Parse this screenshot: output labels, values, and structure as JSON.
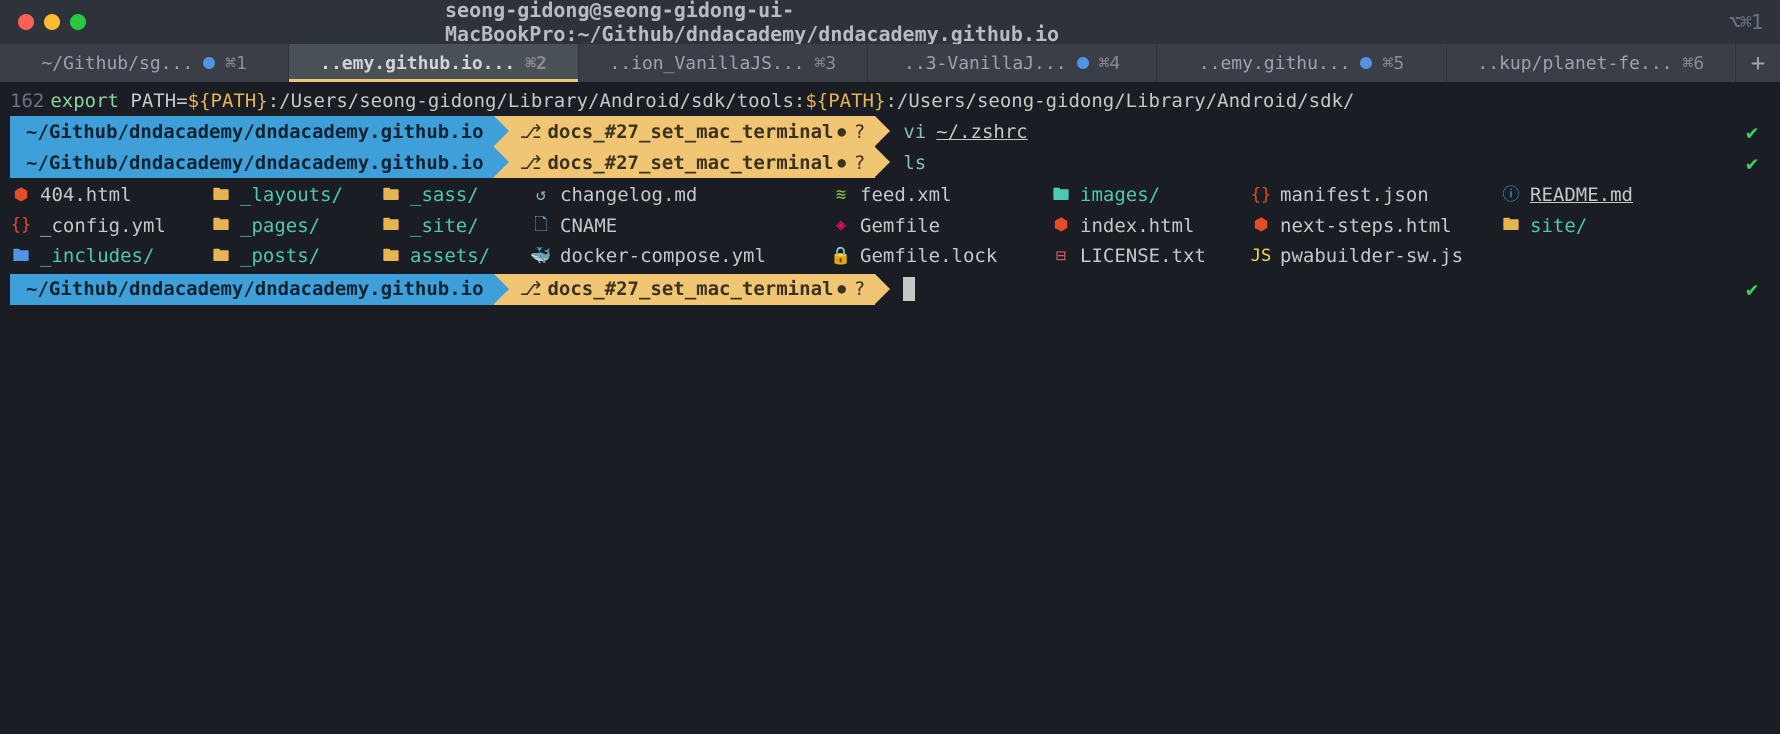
{
  "titlebar": {
    "title": "seong-gidong@seong-gidong-ui-MacBookPro:~/Github/dndacademy/dndacademy.github.io",
    "shortcut_hint": "⌥⌘1"
  },
  "tabs": [
    {
      "label": "~/Github/sg...",
      "dot": true,
      "shortcut": "⌘1",
      "active": false
    },
    {
      "label": "..emy.github.io...",
      "dot": false,
      "shortcut": "⌘2",
      "active": true
    },
    {
      "label": "..ion_VanillaJS...",
      "dot": false,
      "shortcut": "⌘3",
      "active": false
    },
    {
      "label": "..3-VanillaJ...",
      "dot": true,
      "shortcut": "⌘4",
      "active": false
    },
    {
      "label": "..emy.githu...",
      "dot": true,
      "shortcut": "⌘5",
      "active": false
    },
    {
      "label": "..kup/planet-fe...",
      "dot": false,
      "shortcut": "⌘6",
      "active": false
    }
  ],
  "export_line": {
    "linenum": "162",
    "prefix": "export",
    "var": "PATH",
    "eq": "=",
    "p1": "${PATH}",
    "t1": ":/Users/seong-gidong/Library/Android/sdk/tools:",
    "p2": "${PATH}",
    "t2": ":/Users/seong-gidong/Library/Android/sdk/"
  },
  "prompts": [
    {
      "path": "~/Github/dndacademy/dndacademy.github.io",
      "branch": "docs_#27_set_mac_terminal",
      "dirty": "●",
      "untracked": "?",
      "command": "vi",
      "arg": "~/.zshrc",
      "check": "✔"
    },
    {
      "path": "~/Github/dndacademy/dndacademy.github.io",
      "branch": "docs_#27_set_mac_terminal",
      "dirty": "●",
      "untracked": "?",
      "command": "ls",
      "arg": "",
      "check": "✔"
    }
  ],
  "files": [
    [
      {
        "icon": "html5",
        "name": "404.html",
        "cls": "plain"
      },
      {
        "icon": "folder",
        "name": "_layouts/",
        "cls": "teal"
      },
      {
        "icon": "folder",
        "name": "_sass/",
        "cls": "teal"
      },
      {
        "icon": "history",
        "name": "changelog.md",
        "cls": "plain"
      },
      {
        "icon": "rss",
        "name": "feed.xml",
        "cls": "plain"
      },
      {
        "icon": "folder-teal",
        "name": "images/",
        "cls": "teal"
      },
      {
        "icon": "braces",
        "name": "manifest.json",
        "cls": "plain"
      },
      {
        "icon": "info",
        "name": "README.md",
        "cls": "bold"
      }
    ],
    [
      {
        "icon": "braces",
        "name": "_config.yml",
        "cls": "plain"
      },
      {
        "icon": "folder",
        "name": "_pages/",
        "cls": "teal"
      },
      {
        "icon": "folder",
        "name": "_site/",
        "cls": "teal"
      },
      {
        "icon": "file",
        "name": "CNAME",
        "cls": "plain"
      },
      {
        "icon": "ruby",
        "name": "Gemfile",
        "cls": "plain"
      },
      {
        "icon": "html5",
        "name": "index.html",
        "cls": "plain"
      },
      {
        "icon": "html5",
        "name": "next-steps.html",
        "cls": "plain"
      },
      {
        "icon": "folder",
        "name": "site/",
        "cls": "teal"
      }
    ],
    [
      {
        "icon": "folder-blue",
        "name": "_includes/",
        "cls": "teal"
      },
      {
        "icon": "folder",
        "name": "_posts/",
        "cls": "teal"
      },
      {
        "icon": "folder",
        "name": "assets/",
        "cls": "teal"
      },
      {
        "icon": "docker",
        "name": "docker-compose.yml",
        "cls": "plain"
      },
      {
        "icon": "lock",
        "name": "Gemfile.lock",
        "cls": "plain"
      },
      {
        "icon": "license",
        "name": "LICENSE.txt",
        "cls": "plain"
      },
      {
        "icon": "js",
        "name": "pwabuilder-sw.js",
        "cls": "plain"
      },
      {
        "icon": "",
        "name": "",
        "cls": "plain"
      }
    ]
  ],
  "prompt_current": {
    "path": "~/Github/dndacademy/dndacademy.github.io",
    "branch": "docs_#27_set_mac_terminal",
    "dirty": "●",
    "untracked": "?",
    "check": "✔"
  },
  "icons": {
    "html5": "⬢",
    "braces": "{}",
    "folder": "🖿",
    "folder-blue": "🖿",
    "folder-teal": "🖿",
    "history": "↺",
    "file": "🗋",
    "docker": "🐳",
    "rss": "≋",
    "ruby": "◈",
    "lock": "🔒",
    "license": "⊟",
    "js": "JS",
    "info": "ⓘ",
    "branch": "⎇"
  }
}
